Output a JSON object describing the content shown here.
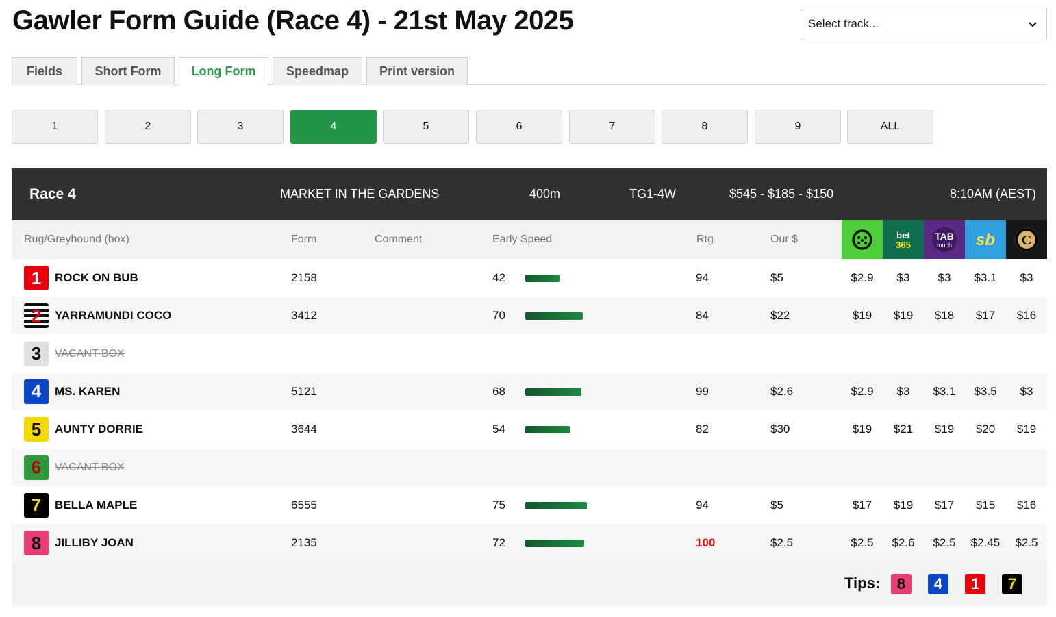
{
  "page": {
    "title": "Gawler Form Guide (Race 4) - 21st May 2025"
  },
  "track_select": {
    "value": "Select track..."
  },
  "tabs": [
    {
      "label": "Fields",
      "active": false
    },
    {
      "label": "Short Form",
      "active": false
    },
    {
      "label": "Long Form",
      "active": true
    },
    {
      "label": "Speedmap",
      "active": false
    },
    {
      "label": "Print version",
      "active": false
    }
  ],
  "race_buttons": [
    "1",
    "2",
    "3",
    "4",
    "5",
    "6",
    "7",
    "8",
    "9",
    "ALL"
  ],
  "active_race": "4",
  "race": {
    "number": "Race 4",
    "name": "MARKET IN THE GARDENS",
    "distance": "400m",
    "grade": "TG1-4W",
    "prizemoney": "$545 - $185 - $150",
    "time": "8:10AM (AEST)"
  },
  "columns": {
    "runner": "Rug/Greyhound (box)",
    "form": "Form",
    "comment": "Comment",
    "early_speed": "Early Speed",
    "rating": "Rtg",
    "our_price": "Our $"
  },
  "bookmakers": [
    {
      "name": "sportsbet-style",
      "icon": "rings-logo-icon",
      "bg": "#4bd03a"
    },
    {
      "name": "bet365",
      "icon": "bet365-logo-icon",
      "bg": "#126e51"
    },
    {
      "name": "TAB touch",
      "icon": "tab-touch-logo-icon",
      "bg": "#5a2a82"
    },
    {
      "name": "sb",
      "icon": "sb-logo-icon",
      "bg": "#2f9fe0"
    },
    {
      "name": "C",
      "icon": "c-logo-icon",
      "bg": "#161616"
    }
  ],
  "runners": [
    {
      "box": "1",
      "name": "ROCK ON BUB",
      "vacant": false,
      "form": "2158",
      "early_speed": "42",
      "rating": "94",
      "top_rated": false,
      "our_price": "$5",
      "odds": [
        "$2.9",
        "$3",
        "$3",
        "$3.1",
        "$3"
      ]
    },
    {
      "box": "2",
      "name": "YARRAMUNDI COCO",
      "vacant": false,
      "form": "3412",
      "early_speed": "70",
      "rating": "84",
      "top_rated": false,
      "our_price": "$22",
      "odds": [
        "$19",
        "$19",
        "$18",
        "$17",
        "$16"
      ]
    },
    {
      "box": "3",
      "name": "VACANT BOX",
      "vacant": true,
      "form": "",
      "early_speed": "",
      "rating": "",
      "top_rated": false,
      "our_price": "",
      "odds": [
        "",
        "",
        "",
        "",
        ""
      ]
    },
    {
      "box": "4",
      "name": "MS. KAREN",
      "vacant": false,
      "form": "5121",
      "early_speed": "68",
      "rating": "99",
      "top_rated": false,
      "our_price": "$2.6",
      "odds": [
        "$2.9",
        "$3",
        "$3.1",
        "$3.5",
        "$3"
      ]
    },
    {
      "box": "5",
      "name": "AUNTY DORRIE",
      "vacant": false,
      "form": "3644",
      "early_speed": "54",
      "rating": "82",
      "top_rated": false,
      "our_price": "$30",
      "odds": [
        "$19",
        "$21",
        "$19",
        "$20",
        "$19"
      ]
    },
    {
      "box": "6",
      "name": "VACANT BOX",
      "vacant": true,
      "form": "",
      "early_speed": "",
      "rating": "",
      "top_rated": false,
      "our_price": "",
      "odds": [
        "",
        "",
        "",
        "",
        ""
      ]
    },
    {
      "box": "7",
      "name": "BELLA MAPLE",
      "vacant": false,
      "form": "6555",
      "early_speed": "75",
      "rating": "94",
      "top_rated": false,
      "our_price": "$5",
      "odds": [
        "$17",
        "$19",
        "$17",
        "$15",
        "$16"
      ]
    },
    {
      "box": "8",
      "name": "JILLIBY JOAN",
      "vacant": false,
      "form": "2135",
      "early_speed": "72",
      "rating": "100",
      "top_rated": true,
      "our_price": "$2.5",
      "odds": [
        "$2.5",
        "$2.6",
        "$2.5",
        "$2.45",
        "$2.5"
      ]
    }
  ],
  "tips": {
    "label": "Tips:",
    "boxes": [
      "8",
      "4",
      "1",
      "7"
    ]
  },
  "rug_colors": {
    "1": {
      "bg": "#e8000b",
      "fg": "#ffffff"
    },
    "2": {
      "bg": "stripes",
      "fg": "#e8000b"
    },
    "3": {
      "bg": "#e0e0e0",
      "fg": "#111111"
    },
    "4": {
      "bg": "#0a46c8",
      "fg": "#ffffff"
    },
    "5": {
      "bg": "#f7d900",
      "fg": "#111111"
    },
    "6": {
      "bg": "#2e9b3a",
      "fg": "#b3001b"
    },
    "7": {
      "bg": "#000000",
      "fg": "#f7d900"
    },
    "8": {
      "bg": "#e83d73",
      "fg": "#111111"
    }
  }
}
